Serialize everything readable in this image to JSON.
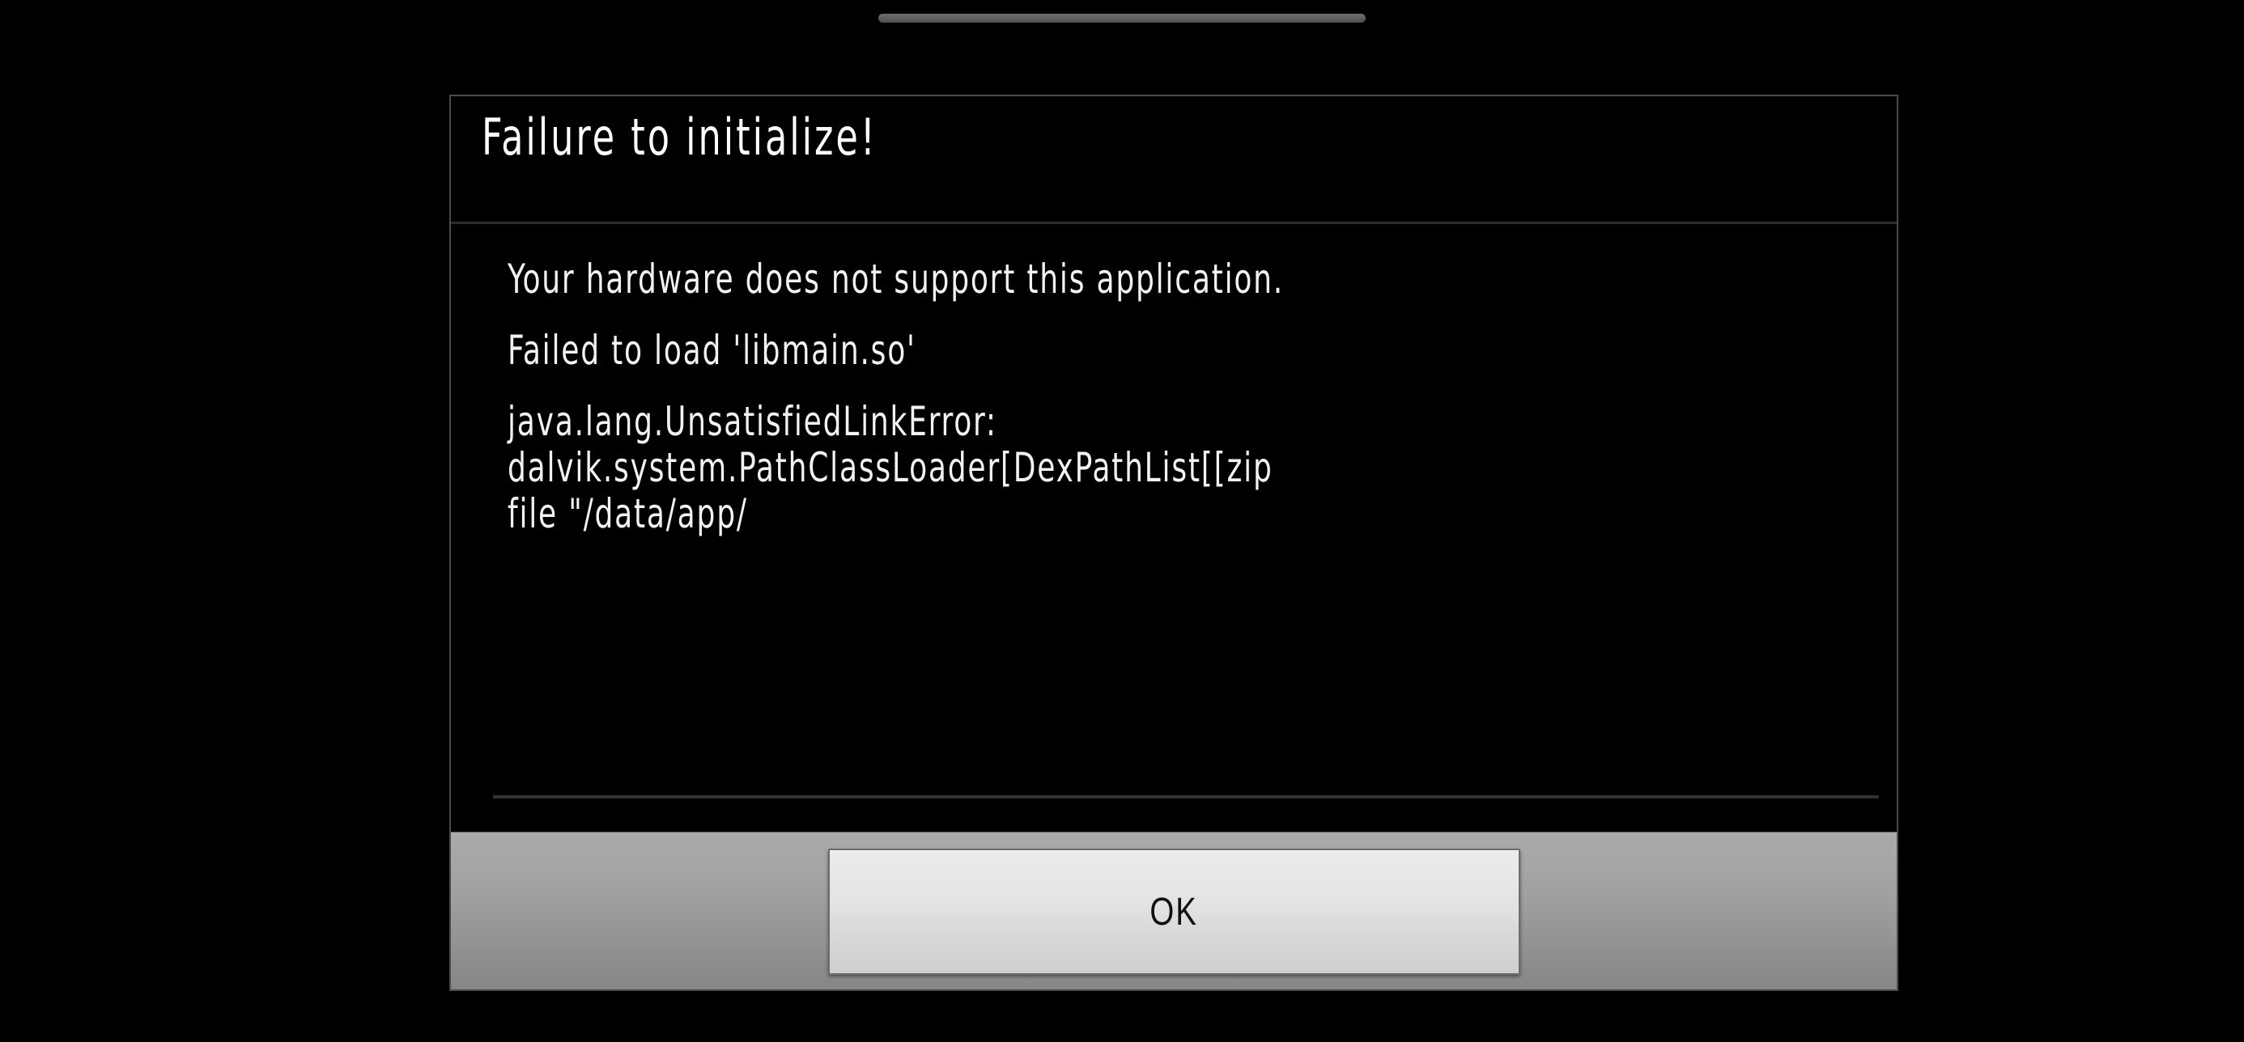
{
  "screen": {
    "background_color": "#000000"
  },
  "status_bar": {
    "handle_name": "drag-handle-pill",
    "color": "#5d5d5d"
  },
  "dialog": {
    "title": "Failure to initialize!",
    "border_color": "#4a4d50",
    "background_color": "#000000",
    "text_color": "#f2f2f2",
    "message_lines": [
      "Your hardware does not support this application.",
      "",
      "Failed to load 'libmain.so'",
      "",
      "java.lang.UnsatisfiedLinkError:",
      "dalvik.system.PathClassLoader[DexPathList[[zip",
      "file \"/data/app/"
    ],
    "footer": {
      "background_color": "#a2a2a2",
      "buttons": [
        {
          "name": "ok-button",
          "label": "OK"
        }
      ]
    }
  }
}
